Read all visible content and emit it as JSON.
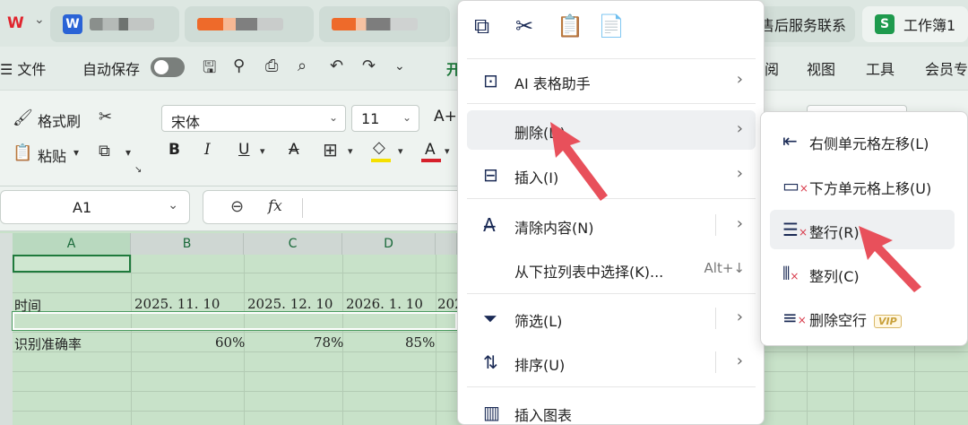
{
  "tabs": {
    "app_logo": "W",
    "doc1_icon": "W",
    "doc4_title": "售后服务联系",
    "doc5_icon": "S",
    "doc5_title": "工作簿1"
  },
  "menu": {
    "file": "☰ 文件",
    "autosave": "自动保存",
    "start_partial": "开",
    "view_partial": "阅",
    "view": "视图",
    "tools": "工具",
    "member": "会员专"
  },
  "ribbon": {
    "format_painter": "格式刷",
    "paste": "粘贴",
    "font_name": "宋体",
    "font_size": "11",
    "bold": "B",
    "italic": "I",
    "underline": "U",
    "strike": "A",
    "font_color": "A",
    "increase_font": "A+"
  },
  "formula_bar": {
    "name_box": "A1",
    "fx": "fx"
  },
  "grid": {
    "columns": [
      "A",
      "B",
      "C",
      "D"
    ],
    "row_time_label": "时间",
    "dates": [
      "2025. 11. 10",
      "2025. 12. 10",
      "2026. 1. 10",
      "202"
    ],
    "row_acc_label": "识别准确率",
    "values": [
      "60%",
      "78%",
      "85%"
    ]
  },
  "context_menu": {
    "items": [
      {
        "label": "AI 表格助手",
        "icon": "ai-icon"
      },
      {
        "label": "删除(D)",
        "icon": "delete-icon"
      },
      {
        "label": "插入(I)",
        "icon": "insert-icon"
      },
      {
        "label": "清除内容(N)",
        "icon": "clear-icon"
      },
      {
        "label": "从下拉列表中选择(K)...",
        "shortcut": "Alt+↓"
      },
      {
        "label": "筛选(L)",
        "icon": "filter-icon"
      },
      {
        "label": "排序(U)",
        "icon": "sort-icon"
      },
      {
        "label": "插入图表",
        "icon": "chart-icon"
      }
    ]
  },
  "submenu": {
    "items": [
      {
        "label": "右侧单元格左移(L)"
      },
      {
        "label": "下方单元格上移(U)"
      },
      {
        "label": "整行(R)"
      },
      {
        "label": "整列(C)"
      },
      {
        "label": "删除空行",
        "badge": "VIP"
      }
    ]
  },
  "colors": {
    "accent_green": "#1f7a3c",
    "annotation_red": "#e8505b",
    "menu_highlight": "#eef0f2"
  }
}
